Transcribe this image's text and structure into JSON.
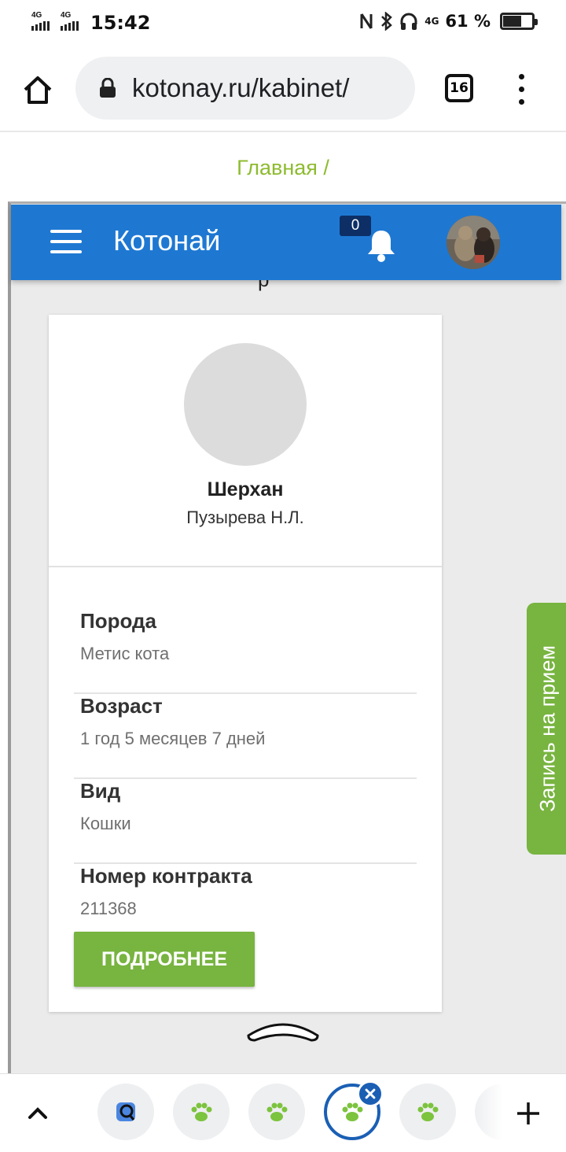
{
  "status_bar": {
    "signal_1": "4G",
    "signal_2": "4G",
    "time": "15:42",
    "network_right": "4G",
    "battery": "61 %"
  },
  "browser": {
    "url": "kotonay.ru/kabinet/",
    "tab_count": "16"
  },
  "breadcrumb": "Главная /",
  "app_header": {
    "title": "Котонай",
    "notification_count": "0"
  },
  "peek_text": "р",
  "pet_card": {
    "name": "Шерхан",
    "owner": "Пузырева Н.Л.",
    "fields": [
      {
        "label": "Порода",
        "value": "Метис кота"
      },
      {
        "label": "Возраст",
        "value": "1 год 5 месяцев 7 дней"
      },
      {
        "label": "Вид",
        "value": "Кошки"
      },
      {
        "label": "Номер контракта",
        "value": "211368"
      }
    ],
    "more_button": "ПОДРОБНЕЕ"
  },
  "appointment_tab": "Запись на прием",
  "colors": {
    "header_blue": "#1e78d2",
    "accent_green": "#78b440",
    "breadcrumb_green": "#8dbb2f",
    "active_tab_blue": "#1a5fb4"
  },
  "tab_strip": {
    "tabs": [
      "search-tab",
      "paw-tab",
      "paw-tab",
      "paw-tab-active",
      "paw-tab",
      "partial-tab"
    ]
  }
}
